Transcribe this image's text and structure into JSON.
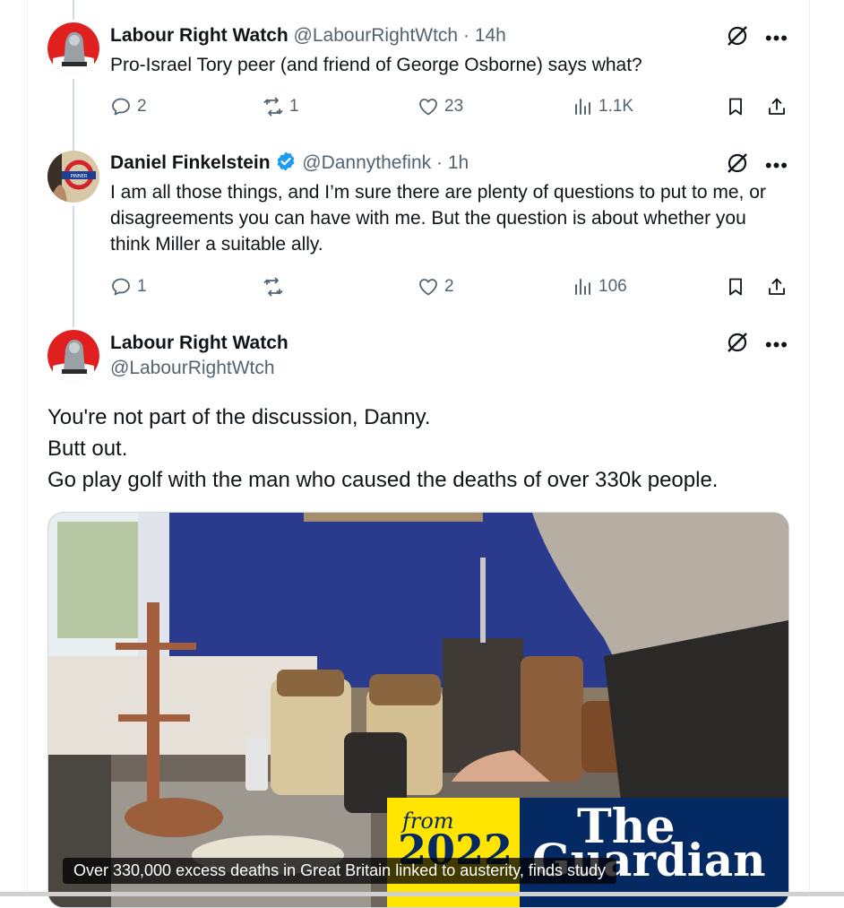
{
  "replies": [
    {
      "name": "Labour Right Watch",
      "handle": "@LabourRightWtch",
      "sep": "·",
      "time": "14h",
      "text": "Pro-Israel Tory peer (and friend of George Osborne) says what?",
      "reply_count": "2",
      "retweet_count": "1",
      "like_count": "23",
      "view_count": "1.1K"
    },
    {
      "name": "Daniel Finkelstein",
      "handle": "@Dannythefink",
      "sep": "·",
      "time": "1h",
      "verified": true,
      "avatar_sign": "PINNER",
      "text": "I am all those things, and I’m sure there are plenty of questions to put to me, or disagreements you can have with me. But the question is about whether you think Miller a suitable ally.",
      "reply_count": "1",
      "retweet_count": "",
      "like_count": "2",
      "view_count": "106"
    }
  ],
  "main_tweet": {
    "name": "Labour Right Watch",
    "handle": "@LabourRightWtch",
    "lines": [
      "You're not part of the discussion, Danny.",
      "Butt out.",
      "Go play golf with the man who caused the deaths of over 330k people."
    ],
    "media": {
      "badge_from": "from",
      "badge_year": "2022",
      "brand_line1": "The",
      "brand_line2": "Guardian",
      "caption": "Over 330,000 excess deaths in Great Britain linked to austerity, finds study"
    }
  },
  "colors": {
    "accent": "#1d9bf0",
    "muted": "#536471",
    "guardian_blue": "#052962",
    "guardian_yellow": "#ffe500"
  },
  "icons": [
    "reply-icon",
    "retweet-icon",
    "like-icon",
    "views-icon",
    "bookmark-icon",
    "share-icon",
    "grok-icon",
    "more-icon",
    "verified-badge-icon"
  ]
}
